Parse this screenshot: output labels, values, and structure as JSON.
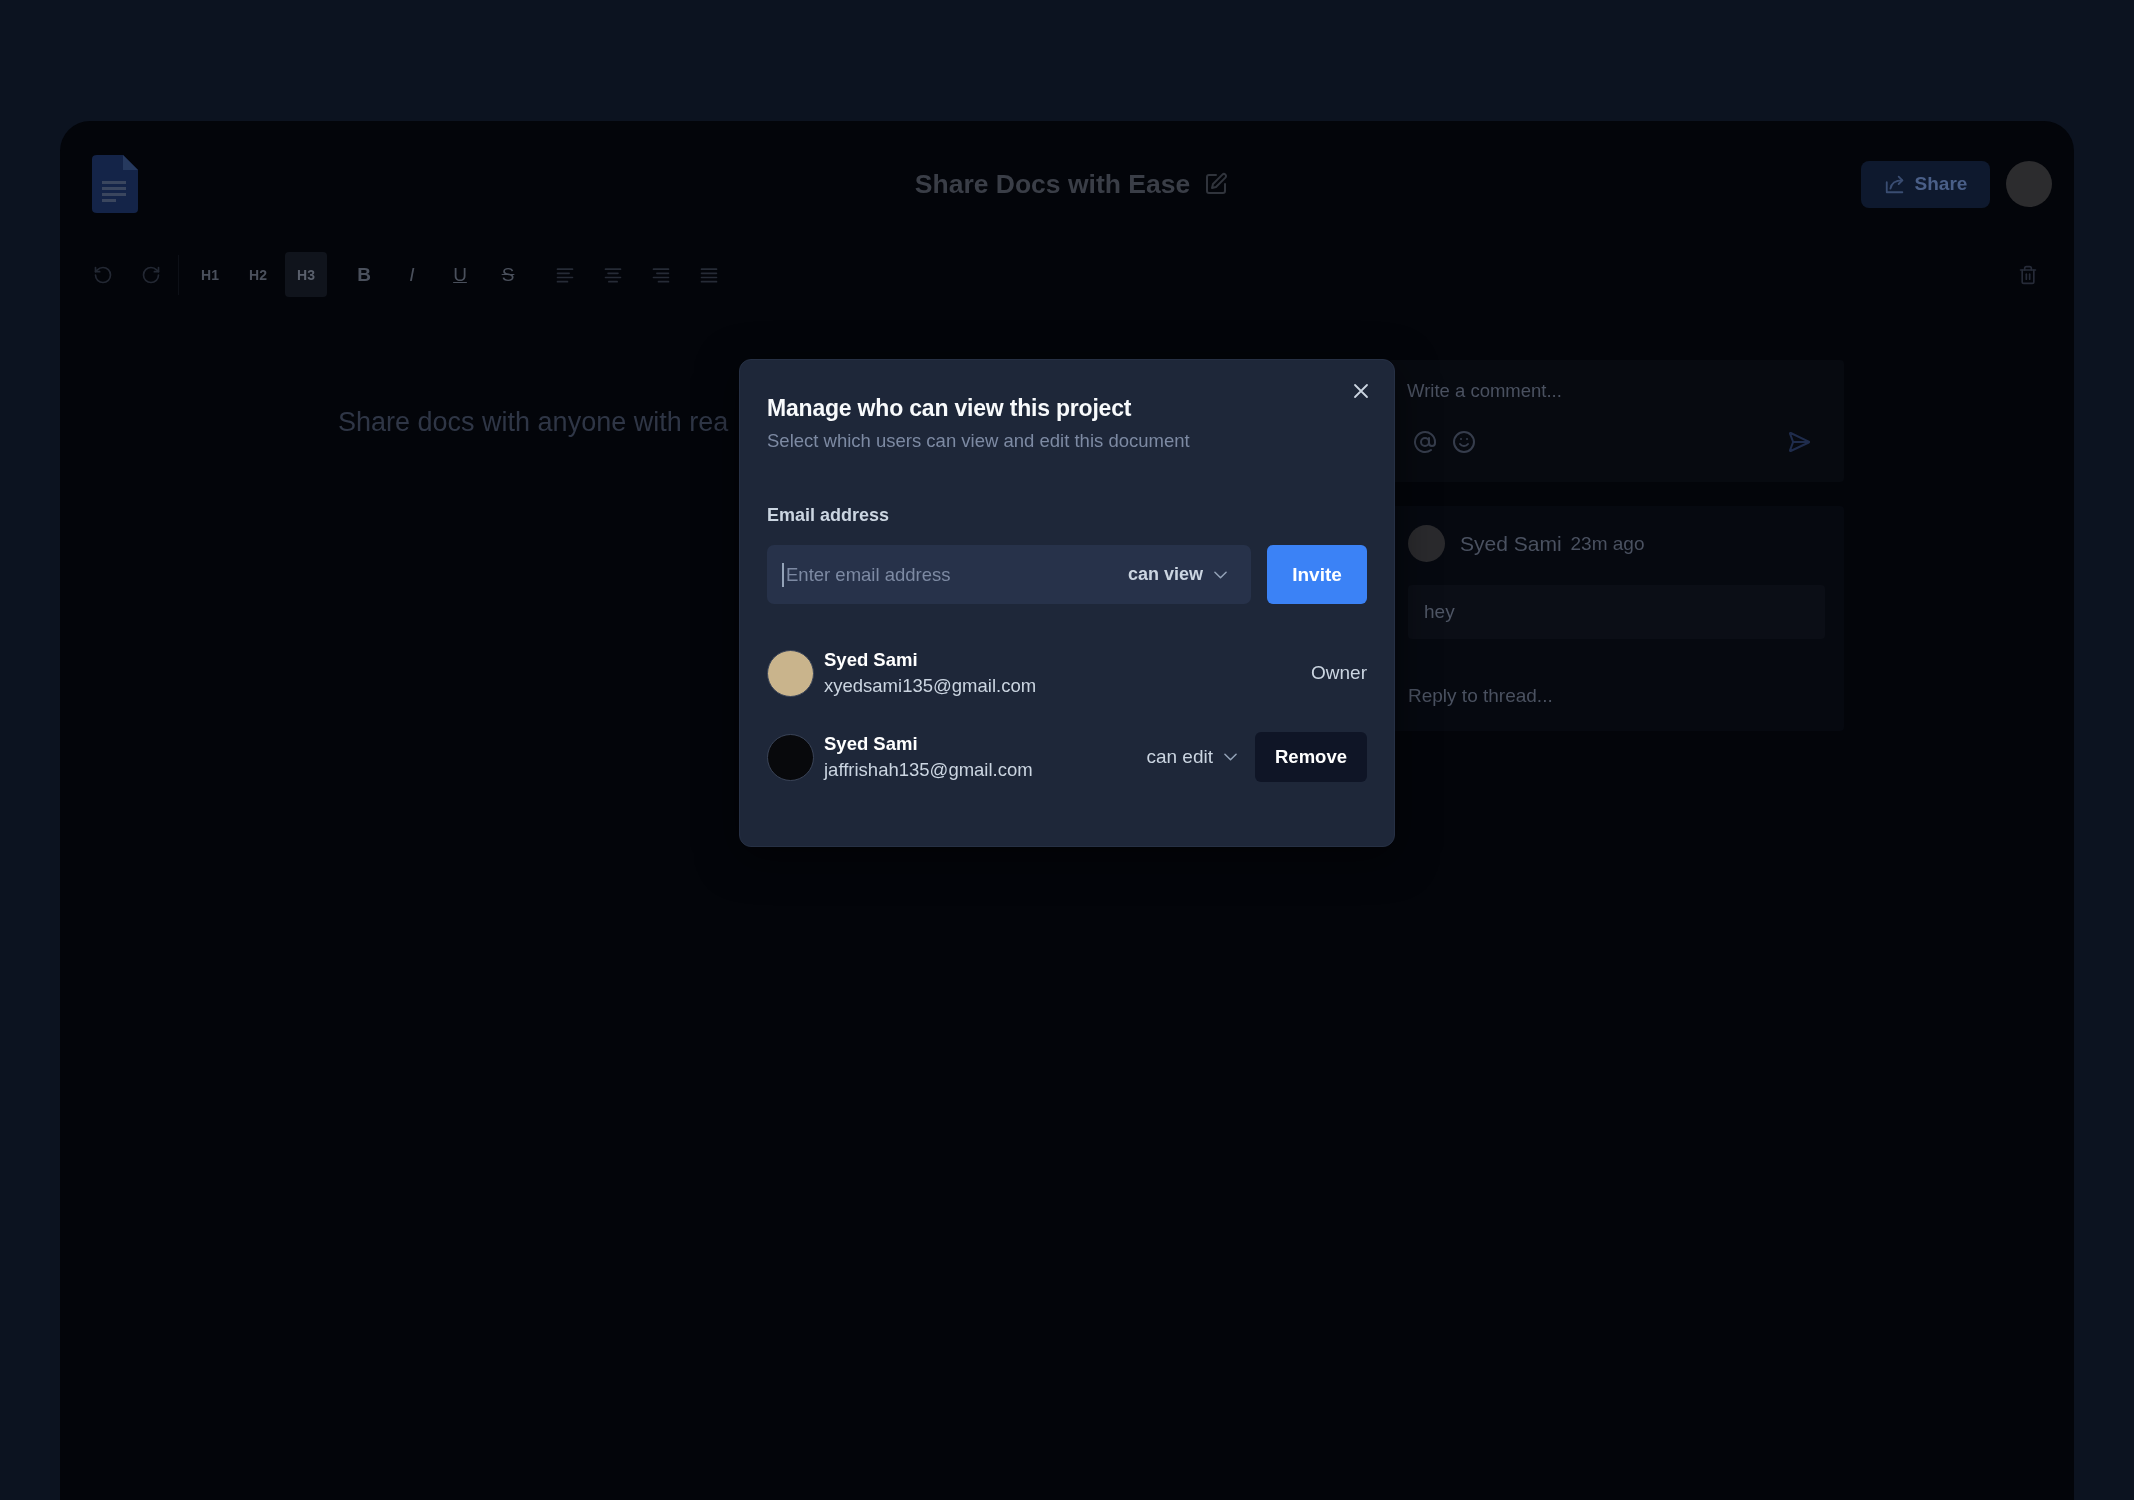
{
  "app": {
    "title": "Share Docs with Ease",
    "share_button": "Share"
  },
  "toolbar": {
    "headings": [
      {
        "label": "H1",
        "selected": false
      },
      {
        "label": "H2",
        "selected": false
      },
      {
        "label": "H3",
        "selected": true
      }
    ],
    "marks": [
      {
        "label": "B",
        "kind": "bold"
      },
      {
        "label": "I",
        "kind": "italic"
      },
      {
        "label": "U",
        "kind": "underline"
      },
      {
        "label": "S",
        "kind": "strikethrough"
      }
    ]
  },
  "document": {
    "text": "Share docs with anyone with rea"
  },
  "comments": {
    "composer": {
      "placeholder": "Write a comment..."
    },
    "threads": [
      {
        "author": "Syed Sami",
        "time": "23m ago",
        "body": "hey",
        "reply": {
          "placeholder": "Reply to thread..."
        }
      }
    ]
  },
  "share_dialog": {
    "title": "Manage who can view this project",
    "subtitle": "Select which users can view and edit this document",
    "email_label": "Email address",
    "email_field": {
      "placeholder": "Enter email address"
    },
    "permission": "can view",
    "invite_button": "Invite",
    "members": [
      {
        "kind": "owner",
        "color": "#c9b48c",
        "name": "Syed Sami",
        "email": "xyedsami135@gmail.com",
        "role": "Owner"
      },
      {
        "kind": "editor",
        "color": "#08090c",
        "name": "Syed Sami",
        "email": "jaffrishah135@gmail.com",
        "permission": "can edit",
        "remove_button": "Remove"
      }
    ]
  }
}
